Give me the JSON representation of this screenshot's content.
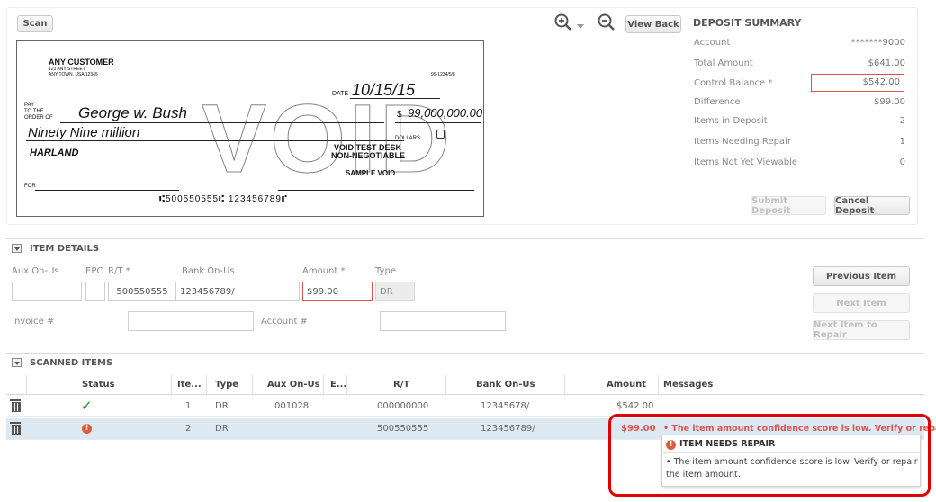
{
  "toolbar": {
    "scan_label": "Scan",
    "view_back_label": "View Back"
  },
  "check": {
    "payer_name": "ANY CUSTOMER",
    "payer_street": "123 ANY STREET",
    "payer_city": "ANY TOWN, USA 12345",
    "routing_fraction": "99-1234/5/8",
    "date_label": "DATE",
    "date_value": "10/15/15",
    "pay_label": "PAY",
    "to_the_label": "TO THE",
    "order_of_label": "ORDER OF",
    "payee": "George w. Bush",
    "amount_symbol": "$",
    "amount_written": "99,000,000.00",
    "amount_words": "Ninety Nine million",
    "dollars_label": "DOLLARS",
    "bank_name": "HARLAND",
    "stamp_line1": "VOID TEST DESK",
    "stamp_line2": "NON-NEGOTIABLE",
    "sample_void": "SAMPLE VOID",
    "void_mark": "VOID",
    "for_label": "FOR",
    "micr_line": "⑆500550555⑆  123456789⑈"
  },
  "summary": {
    "title": "DEPOSIT SUMMARY",
    "account_label": "Account",
    "account_value": "*******9000",
    "total_amount_label": "Total Amount",
    "total_amount_value": "$641.00",
    "control_balance_label": "Control Balance *",
    "control_balance_value": "$542.00",
    "difference_label": "Difference",
    "difference_value": "$99.00",
    "items_in_deposit_label": "Items in Deposit",
    "items_in_deposit_value": "2",
    "items_needing_repair_label": "Items Needing Repair",
    "items_needing_repair_value": "1",
    "items_not_viewable_label": "Items Not Yet Viewable",
    "items_not_viewable_value": "0",
    "submit_label": "Submit Deposit",
    "cancel_label": "Cancel Deposit"
  },
  "item_details": {
    "section_title": "ITEM DETAILS",
    "aux_on_us_label": "Aux On-Us",
    "aux_on_us_value": "",
    "epc_label": "EPC",
    "epc_value": "",
    "rt_label": "R/T *",
    "rt_value": "500550555",
    "bank_on_us_label": "Bank On-Us",
    "bank_on_us_value": "123456789/",
    "amount_label": "Amount *",
    "amount_value": "$99.00",
    "type_label": "Type",
    "type_value": "DR",
    "invoice_label": "Invoice #",
    "invoice_value": "",
    "account_label": "Account #",
    "account_value": "",
    "previous_item": "Previous Item",
    "next_item": "Next Item",
    "next_item_repair": "Next Item to Repair"
  },
  "scanned_items": {
    "section_title": "SCANNED ITEMS",
    "columns": [
      "Status",
      "Ite...",
      "Type",
      "Aux On-Us",
      "E...",
      "R/T",
      "Bank On-Us",
      "Amount",
      "Messages"
    ],
    "rows": [
      {
        "status": "ok",
        "item": "1",
        "type": "DR",
        "aux_on_us": "001028",
        "epc": "",
        "rt": "000000000",
        "bank_on_us": "12345678/",
        "amount": "$542.00",
        "message": ""
      },
      {
        "status": "error",
        "item": "2",
        "type": "DR",
        "aux_on_us": "",
        "epc": "",
        "rt": "500550555",
        "bank_on_us": "123456789/",
        "amount": "$99.00",
        "message": "• The item amount confidence score is low. Verify or repa..."
      }
    ]
  },
  "tooltip": {
    "title": "ITEM NEEDS REPAIR",
    "body": "• The item amount confidence score is low. Verify or repair the item amount."
  },
  "colors": {
    "error": "#d9534f",
    "selected_row": "#dce8f2",
    "ok_check": "#2e8b2e",
    "callout": "#e00000"
  }
}
